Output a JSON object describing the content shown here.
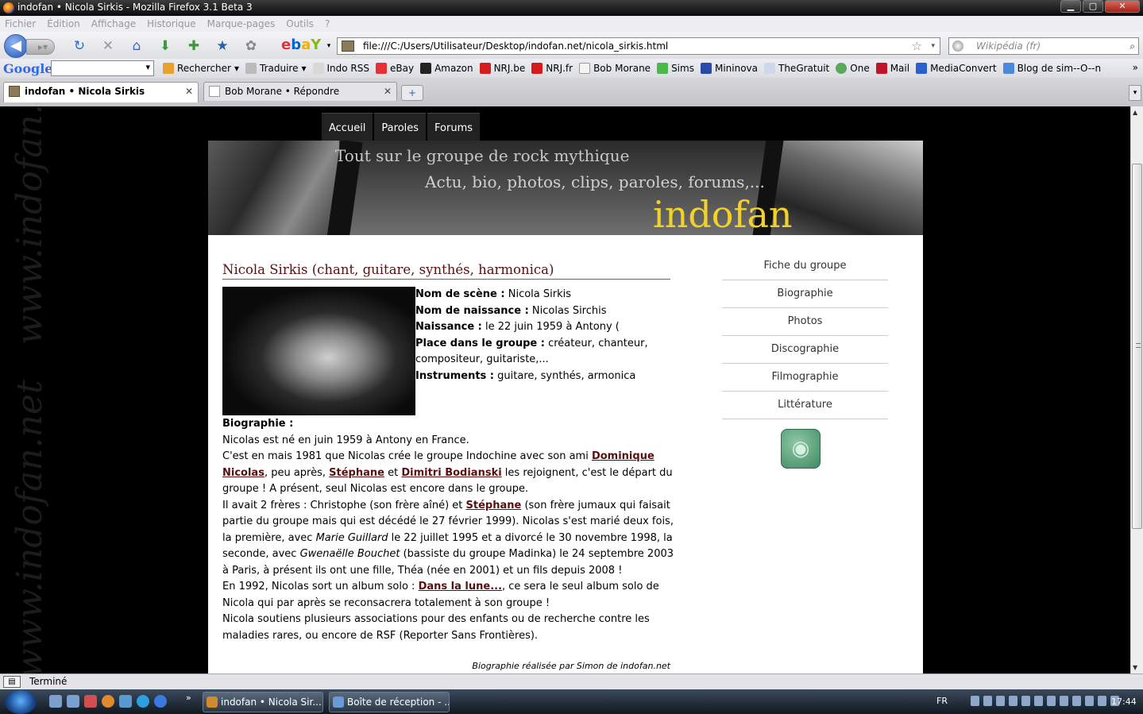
{
  "window": {
    "title": "indofan • Nicola Sirkis - Mozilla Firefox 3.1 Beta 3",
    "min": "▁",
    "max": "▢",
    "close": "✕"
  },
  "menu": [
    "Fichier",
    "Édition",
    "Affichage",
    "Historique",
    "Marque-pages",
    "Outils",
    "?"
  ],
  "nav": {
    "url": "file:///C:/Users/Utilisateur/Desktop/indofan.net/nicola_sirkis.html",
    "search_placeholder": "Wikipédia (fr)"
  },
  "google": {
    "logo": "Google",
    "search_button": "Rechercher"
  },
  "bookmarks": [
    "Traduire",
    "Indo RSS",
    "eBay",
    "Amazon",
    "NRJ.be",
    "NRJ.fr",
    "Bob Morane",
    "Sims",
    "Mininova",
    "TheGratuit",
    "One",
    "Mail",
    "MediaConvert",
    "Blog de sim--O--n"
  ],
  "tabs": [
    {
      "title": "indofan • Nicola Sirkis"
    },
    {
      "title": "Bob Morane • Répondre"
    }
  ],
  "watermark": [
    "www.indofan.ne",
    "www.indofan.net"
  ],
  "site": {
    "nav": [
      "Accueil",
      "Paroles",
      "Forums"
    ],
    "banner": {
      "line1": "Tout sur le groupe de rock mythique",
      "line2": "Actu, bio, photos, clips, paroles, forums,...",
      "brand": "indofan"
    },
    "page_title": "Nicola Sirkis (chant, guitare, synthés, harmonica)",
    "facts": [
      {
        "label": "Nom de scène :",
        "value": " Nicola Sirkis"
      },
      {
        "label": "Nom de naissance :",
        "value": " Nicolas Sirchis"
      },
      {
        "label": "Naissance :",
        "value": " le 22 juin 1959 à Antony ("
      },
      {
        "label": "Place dans le groupe :",
        "value": " créateur, chanteur, compositeur, guitariste,..."
      },
      {
        "label": "Instruments :",
        "value": " guitare, synthés, armonica"
      }
    ],
    "bio_heading": "Biographie :",
    "bio": {
      "p1": "Nicolas est né en juin 1959 à Antony en France.",
      "p2a": "C'est en mais 1981 que Nicolas crée le groupe Indochine avec son ami ",
      "link_dominique": "Dominique Nicolas",
      "p2b": ", peu après, ",
      "link_stephane": "Stéphane",
      "p2c": " et ",
      "link_dimitri": "Dimitri Bodianski",
      "p2d": " les rejoignent, c'est le départ du groupe ! A présent, seul Nicolas est encore dans le groupe.",
      "p3a": "Il avait 2 frères : Christophe (son frère aîné) et ",
      "link_stephane2": "Stéphane",
      "p3b": " (son frère jumaux qui faisait partie du groupe mais qui est décédé le 27 février 1999). Nicolas s'est marié deux fois, la première, avec ",
      "p3_marie": "Marie Guillard",
      "p3c": " le 22 juillet 1995 et a divorcé le 30 novembre 1998, la seconde, avec ",
      "p3_gwen": "Gwenaëlle Bouchet",
      "p3d": " (bassiste du groupe Madinka) le 24 septembre 2003 à Paris, à présent ils ont une fille, Théa (née en 2001) et un fils depuis 2008 !",
      "p4a": "En 1992, Nicolas sort un album solo : ",
      "link_lune": "Dans la lune...",
      "p4b": ", ce sera le seul album solo de Nicola qui par après se reconsacrera totalement à son groupe !",
      "p5": "Nicola soutiens plusieurs associations pour des enfants ou de recherche contre les maladies rares, ou encore de RSF (Reporter Sans Frontières)."
    },
    "credit": "Biographie réalisée par Simon de indofan.net",
    "sidebar": [
      "Fiche du groupe",
      "Biographie",
      "Photos",
      "Discographie",
      "Filmographie",
      "Littérature"
    ]
  },
  "status": "Terminé",
  "taskbar": {
    "tasks": [
      "indofan • Nicola Sir...",
      "Boîte de réception - ..."
    ],
    "lang": "FR",
    "clock": "17:44"
  }
}
